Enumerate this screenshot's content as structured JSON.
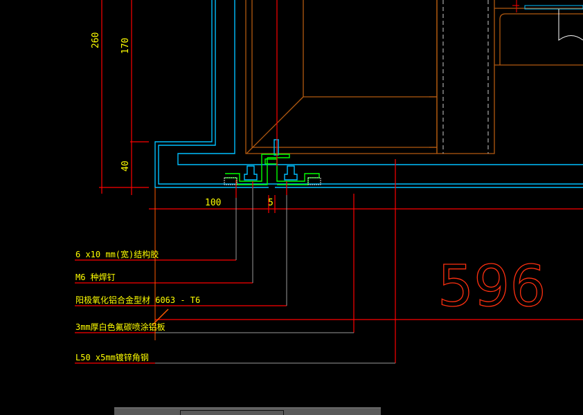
{
  "drawing": {
    "dimensions": {
      "d260": "260",
      "d170": "170",
      "d40": "40",
      "d100": "100",
      "d5": "5"
    },
    "labels": [
      "6 x10 mm(宽)结构胶",
      "M6 种焊钉",
      "阳极氧化铝合金型材 6063 - T6",
      "3mm厚白色氟碳喷涂铝板",
      "L50 x5mm镀锌角钢"
    ],
    "big_number": "596"
  },
  "colors": {
    "cyan": "#00bfff",
    "brown": "#b35a10",
    "red": "#ff0000",
    "green": "#00ff00",
    "yellow": "#ffff00",
    "gray": "#9a9a9a",
    "orange": "#ff5a00"
  }
}
